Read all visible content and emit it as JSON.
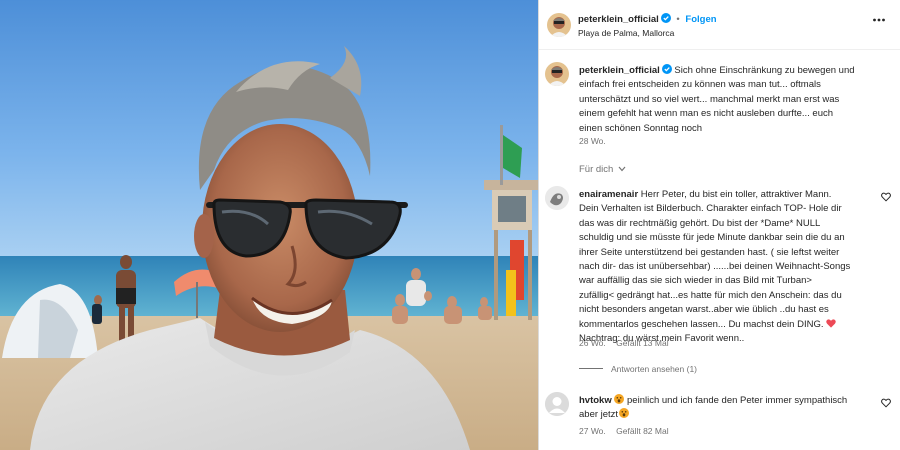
{
  "post": {
    "author": "peterklein_official",
    "follow_label": "Folgen",
    "separator": "•",
    "location": "Playa de Palma, Mallorca",
    "more_label": "..."
  },
  "caption": {
    "username": "peterklein_official",
    "lines": [
      "Sich ohne Einschränkung zu bewegen und",
      "einfach frei entscheiden zu können was man tut... oftmals",
      "unterschätzt und so viel wert... manchmal merkt man erst was",
      "einem gefehlt hat wenn man es nicht ausleben durfte... euch",
      "einen schönen Sonntag noch"
    ],
    "time": "28 Wo."
  },
  "translate": {
    "label": "Für dich"
  },
  "comments": [
    {
      "username": "enairamenair",
      "lines": [
        "Herr Peter, du bist ein toller, attraktiver Mann.",
        "Dein Verhalten ist Bilderbuch. Charakter einfach TOP- Hole dir",
        "das was dir rechtmäßig gehört. Du bist der *Dame* NULL",
        "schuldig und sie müsste für jede Minute dankbar sein die du an",
        "ihrer Seite unterstützend bei gestanden hast. ( sie leftst weiter",
        "nach dir- das ist unübersehbar) ......bei deinen Weihnacht-Songs",
        "war auffällig das sie sich wieder in das Bild mit Turban>",
        "zufällig< gedrängt hat...es hatte für mich den Anschein: das du",
        "nicht besonders angetan warst..aber wie üblich ..du hast es",
        "kommentarlos geschehen lassen... Du machst dein DING.",
        "Nachtrag: du wärst mein Favorit wenn.."
      ],
      "time": "26 Wo.",
      "likes": "Gefällt 13 Mal",
      "replies_label": "Antworten ansehen (1)"
    },
    {
      "username": "hvtokw",
      "lines": [
        "peinlich und ich fande den Peter immer sympathisch",
        "aber jetzt"
      ],
      "time": "27 Wo.",
      "likes": "Gefällt 82 Mal"
    }
  ],
  "icons": {
    "verified": "verified-badge-icon",
    "more": "more-options-icon",
    "heart": "heart-icon",
    "chevron": "chevron-down-icon",
    "emoji": "shocked-face-emoji-icon"
  },
  "colors": {
    "accent": "#0095f6",
    "text": "#262626",
    "muted": "#737373",
    "emoji_heart": "#ed4956",
    "emoji_face": "#f5a623"
  }
}
